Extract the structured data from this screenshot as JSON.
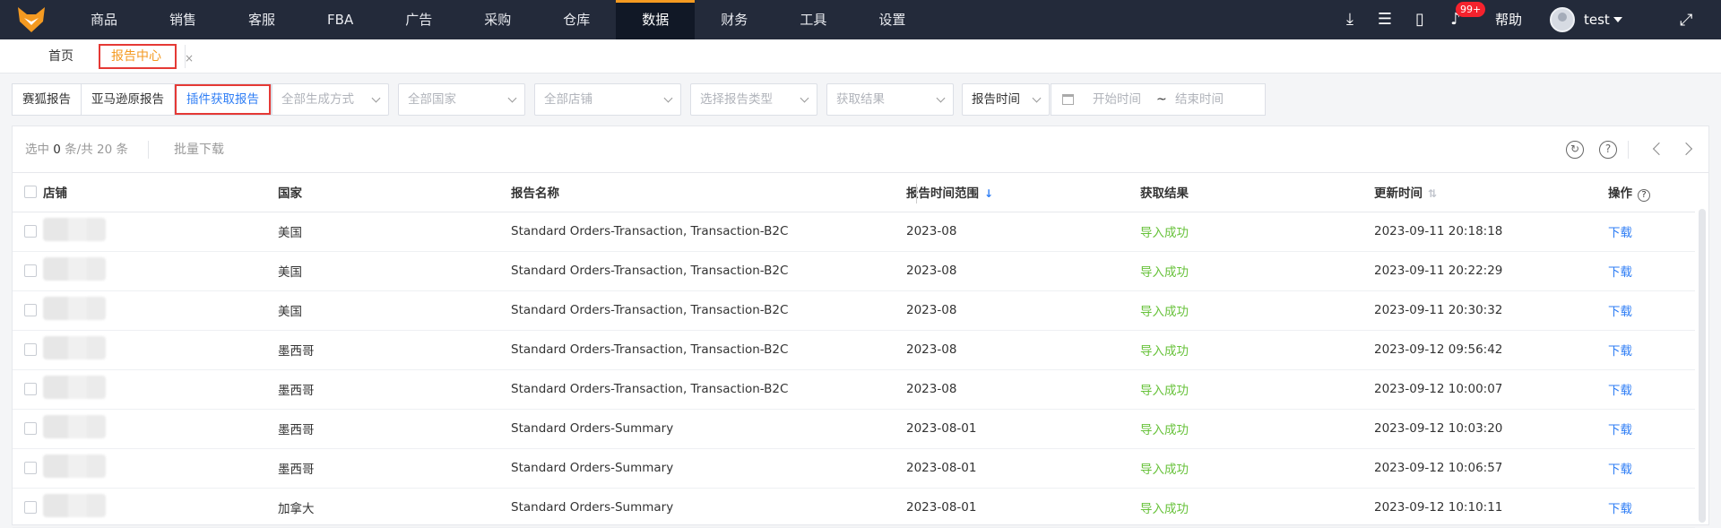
{
  "nav": {
    "items": [
      "商品",
      "销售",
      "客服",
      "FBA",
      "广告",
      "采购",
      "仓库",
      "数据",
      "财务",
      "工具",
      "设置"
    ],
    "active_index": 7,
    "notification_badge": "99+",
    "help": "帮助",
    "user": "test"
  },
  "tabs": {
    "home": "首页",
    "active": "报告中心",
    "close": "×"
  },
  "filters": {
    "segments": [
      "赛狐报告",
      "亚马逊原报告",
      "插件获取报告"
    ],
    "active_segment": 2,
    "generation": "全部生成方式",
    "country": "全部国家",
    "store": "全部店铺",
    "report_type": "选择报告类型",
    "result": "获取结果",
    "time_type": "报告时间",
    "date_start": "开始时间",
    "date_sep": "~",
    "date_end": "结束时间"
  },
  "toolbar": {
    "selected_prefix": "选中 ",
    "selected_count": "0",
    "selected_suffix": " 条/共 20 条",
    "batch": "批量下载"
  },
  "table": {
    "headers": {
      "store": "店铺",
      "country": "国家",
      "name": "报告名称",
      "range": "报告时间范围",
      "sort_range": "↓",
      "result": "获取结果",
      "updated": "更新时间",
      "sort_updated": "⇅",
      "action": "操作"
    },
    "rows": [
      {
        "country": "美国",
        "name": "Standard Orders-Transaction, Transaction-B2C",
        "range": "2023-08",
        "result": "导入成功",
        "updated": "2023-09-11 20:18:18",
        "action": "下载"
      },
      {
        "country": "美国",
        "name": "Standard Orders-Transaction, Transaction-B2C",
        "range": "2023-08",
        "result": "导入成功",
        "updated": "2023-09-11 20:22:29",
        "action": "下载"
      },
      {
        "country": "美国",
        "name": "Standard Orders-Transaction, Transaction-B2C",
        "range": "2023-08",
        "result": "导入成功",
        "updated": "2023-09-11 20:30:32",
        "action": "下载"
      },
      {
        "country": "墨西哥",
        "name": "Standard Orders-Transaction, Transaction-B2C",
        "range": "2023-08",
        "result": "导入成功",
        "updated": "2023-09-12 09:56:42",
        "action": "下载"
      },
      {
        "country": "墨西哥",
        "name": "Standard Orders-Transaction, Transaction-B2C",
        "range": "2023-08",
        "result": "导入成功",
        "updated": "2023-09-12 10:00:07",
        "action": "下载"
      },
      {
        "country": "墨西哥",
        "name": "Standard Orders-Summary",
        "range": "2023-08-01",
        "result": "导入成功",
        "updated": "2023-09-12 10:03:20",
        "action": "下载"
      },
      {
        "country": "墨西哥",
        "name": "Standard Orders-Summary",
        "range": "2023-08-01",
        "result": "导入成功",
        "updated": "2023-09-12 10:06:57",
        "action": "下载"
      },
      {
        "country": "加拿大",
        "name": "Standard Orders-Summary",
        "range": "2023-08-01",
        "result": "导入成功",
        "updated": "2023-09-12 10:10:11",
        "action": "下载"
      }
    ]
  },
  "colors": {
    "topbar": "#232a3a",
    "accent": "#f49a21",
    "link": "#2f7ef5",
    "success": "#67c23a",
    "highlight_border": "#e53935"
  }
}
